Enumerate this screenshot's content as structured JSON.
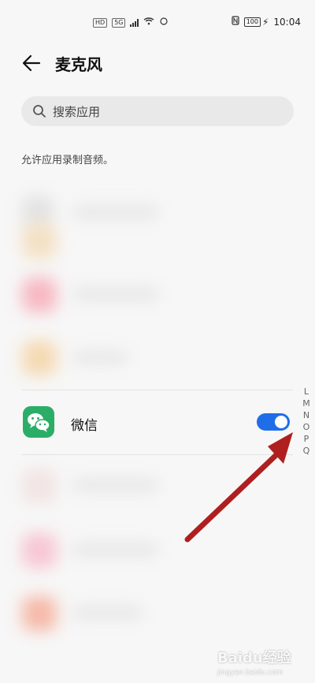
{
  "status_bar": {
    "time": "10:04",
    "battery": "100",
    "network_badges": [
      "HD",
      "5G"
    ],
    "provider_badge": ""
  },
  "header": {
    "title": "麦克风"
  },
  "search": {
    "placeholder": "搜索应用"
  },
  "section": {
    "hint": "允许应用录制音频。"
  },
  "apps": [
    {
      "name": "微信",
      "enabled": true
    }
  ],
  "alpha_index": [
    "L",
    "M",
    "N",
    "O",
    "P",
    "Q"
  ],
  "watermark": {
    "title": "Baidu经验",
    "sub": "jingyan.baidu.com"
  },
  "colors": {
    "toggle_on": "#1f6ee8",
    "wechat_green": "#2aae67",
    "arrow_red": "#b01f1f"
  }
}
